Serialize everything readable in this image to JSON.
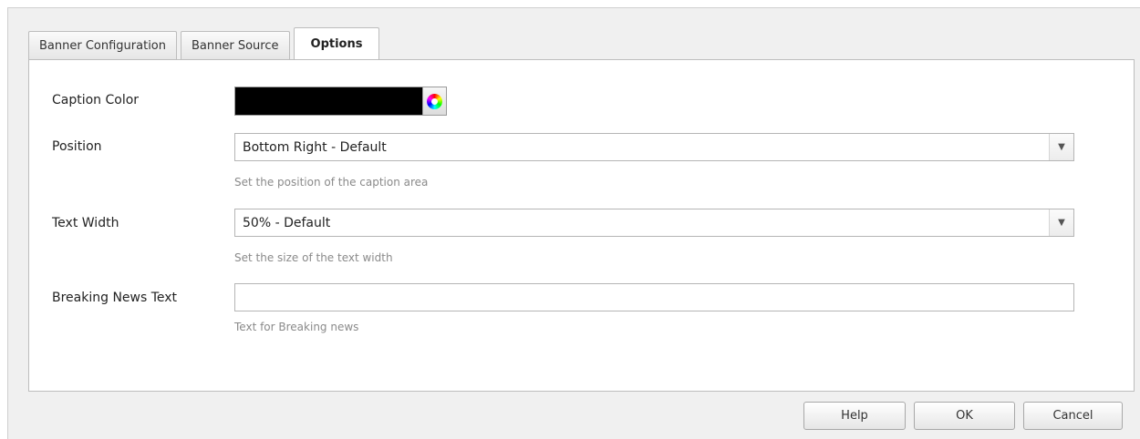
{
  "tabs": [
    {
      "label": "Banner Configuration"
    },
    {
      "label": "Banner Source"
    },
    {
      "label": "Options",
      "active": true
    }
  ],
  "form": {
    "caption_color": {
      "label": "Caption Color",
      "value_color": "#000000",
      "icon": "color-wheel-icon"
    },
    "position": {
      "label": "Position",
      "selected": "Bottom Right - Default",
      "help": "Set the position of the caption area"
    },
    "text_width": {
      "label": "Text Width",
      "selected": "50% - Default",
      "help": "Set the size of the text width"
    },
    "breaking_news": {
      "label": "Breaking News Text",
      "value": "",
      "help": "Text for Breaking news"
    }
  },
  "buttons": {
    "help": "Help",
    "ok": "OK",
    "cancel": "Cancel"
  },
  "icons": {
    "dropdown": "chevron-down-icon",
    "dropdown_glyph": "▼"
  }
}
